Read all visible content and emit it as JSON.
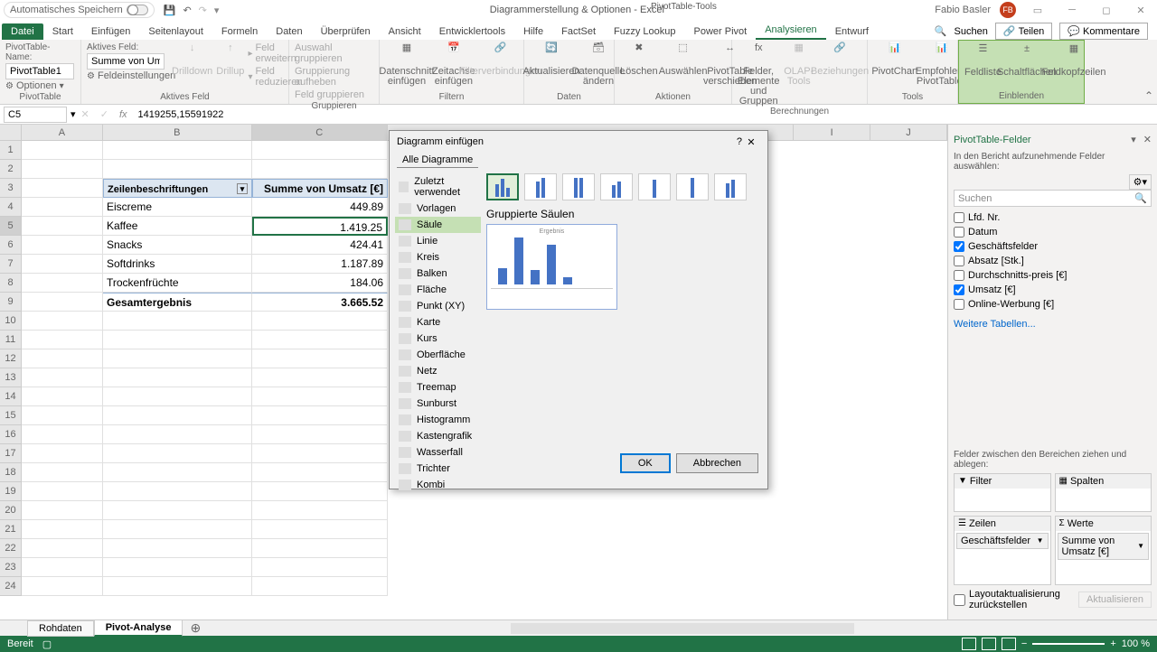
{
  "titlebar": {
    "autosave": "Automatisches Speichern",
    "doc_title": "Diagrammerstellung & Optionen - Excel",
    "tools_title": "PivotTable-Tools",
    "username": "Fabio Basler",
    "avatar_initials": "FB"
  },
  "tabs": {
    "file": "Datei",
    "start": "Start",
    "einfugen": "Einfügen",
    "seitenlayout": "Seitenlayout",
    "formeln": "Formeln",
    "daten": "Daten",
    "uberprufen": "Überprüfen",
    "ansicht": "Ansicht",
    "entwicklertools": "Entwicklertools",
    "hilfe": "Hilfe",
    "factset": "FactSet",
    "fuzzy": "Fuzzy Lookup",
    "powerpivot": "Power Pivot",
    "analysieren": "Analysieren",
    "entwurf": "Entwurf",
    "suchen": "Suchen",
    "teilen": "Teilen",
    "kommentare": "Kommentare"
  },
  "ribbon": {
    "pt_name_label": "PivotTable-Name:",
    "pt_name": "PivotTable1",
    "optionen": "Optionen",
    "aktives_feld": "Aktives Feld:",
    "aktives_value": "Summe von Ums",
    "feldeinstellungen": "Feldeinstellungen",
    "drilldown": "Drilldown",
    "drillup": "Drillup",
    "feld_erweitern": "Feld erweitern",
    "feld_reduzieren": "Feld reduzieren",
    "auswahl_grupp": "Auswahl gruppieren",
    "grupp_aufheben": "Gruppierung aufheben",
    "feld_grupp": "Feld gruppieren",
    "datenschnitt": "Datenschnitt einfügen",
    "zeitachse": "Zeitachse einfügen",
    "filterverbindungen": "Filterverbindungen",
    "aktualisieren": "Aktualisieren",
    "datenquelle": "Datenquelle ändern",
    "loschen": "Löschen",
    "auswahlen": "Auswählen",
    "verschieben": "PivotTable verschieben",
    "felder_elemente": "Felder, Elemente und Gruppen",
    "olap": "OLAP-Tools",
    "beziehungen": "Beziehungen",
    "pivotchart": "PivotChart",
    "empfohlene": "Empfohlene PivotTables",
    "feldliste": "Feldliste",
    "schaltflachen": "Schaltflächen",
    "feldkopfzeilen": "Feldkopfzeilen",
    "g_pivottable": "PivotTable",
    "g_aktives": "Aktives Feld",
    "g_gruppieren": "Gruppieren",
    "g_filtern": "Filtern",
    "g_daten": "Daten",
    "g_aktionen": "Aktionen",
    "g_berechnungen": "Berechnungen",
    "g_tools": "Tools",
    "g_einblenden": "Einblenden"
  },
  "formula": {
    "namebox": "C5",
    "value": "1419255,15591922"
  },
  "cols": [
    "A",
    "B",
    "C",
    "I",
    "J"
  ],
  "table": {
    "header_labels": "Zeilenbeschriftungen",
    "header_sum": "Summe von Umsatz [€]",
    "rows": [
      {
        "label": "Eiscreme",
        "value": "449.89"
      },
      {
        "label": "Kaffee",
        "value": "1.419.25"
      },
      {
        "label": "Snacks",
        "value": "424.41"
      },
      {
        "label": "Softdrinks",
        "value": "1.187.89"
      },
      {
        "label": "Trockenfrüchte",
        "value": "184.06"
      }
    ],
    "total_label": "Gesamtergebnis",
    "total_value": "3.665.52"
  },
  "dialog": {
    "title": "Diagramm einfügen",
    "tab_all": "Alle Diagramme",
    "types": [
      "Zuletzt verwendet",
      "Vorlagen",
      "Säule",
      "Linie",
      "Kreis",
      "Balken",
      "Fläche",
      "Punkt (XY)",
      "Karte",
      "Kurs",
      "Oberfläche",
      "Netz",
      "Treemap",
      "Sunburst",
      "Histogramm",
      "Kastengrafik",
      "Wasserfall",
      "Trichter",
      "Kombi"
    ],
    "selected_type": "Gruppierte Säulen",
    "preview_title": "Ergebnis",
    "ok": "OK",
    "cancel": "Abbrechen"
  },
  "fields": {
    "title": "PivotTable-Felder",
    "subtitle": "In den Bericht aufzunehmende Felder auswählen:",
    "search": "Suchen",
    "items": [
      {
        "label": "Lfd. Nr.",
        "checked": false
      },
      {
        "label": "Datum",
        "checked": false
      },
      {
        "label": "Geschäftsfelder",
        "checked": true
      },
      {
        "label": "Absatz [Stk.]",
        "checked": false
      },
      {
        "label": "Durchschnitts-preis [€]",
        "checked": false
      },
      {
        "label": "Umsatz [€]",
        "checked": true
      },
      {
        "label": "Online-Werbung [€]",
        "checked": false
      }
    ],
    "more_tables": "Weitere Tabellen...",
    "drag_label": "Felder zwischen den Bereichen ziehen und ablegen:",
    "filter": "Filter",
    "spalten": "Spalten",
    "zeilen": "Zeilen",
    "werte": "Werte",
    "zeilen_item": "Geschäftsfelder",
    "werte_item": "Summe von Umsatz [€]",
    "defer": "Layoutaktualisierung zurückstellen",
    "update": "Aktualisieren"
  },
  "sheets": {
    "rohdaten": "Rohdaten",
    "pivot": "Pivot-Analyse"
  },
  "status": {
    "ready": "Bereit",
    "zoom": "100 %"
  }
}
